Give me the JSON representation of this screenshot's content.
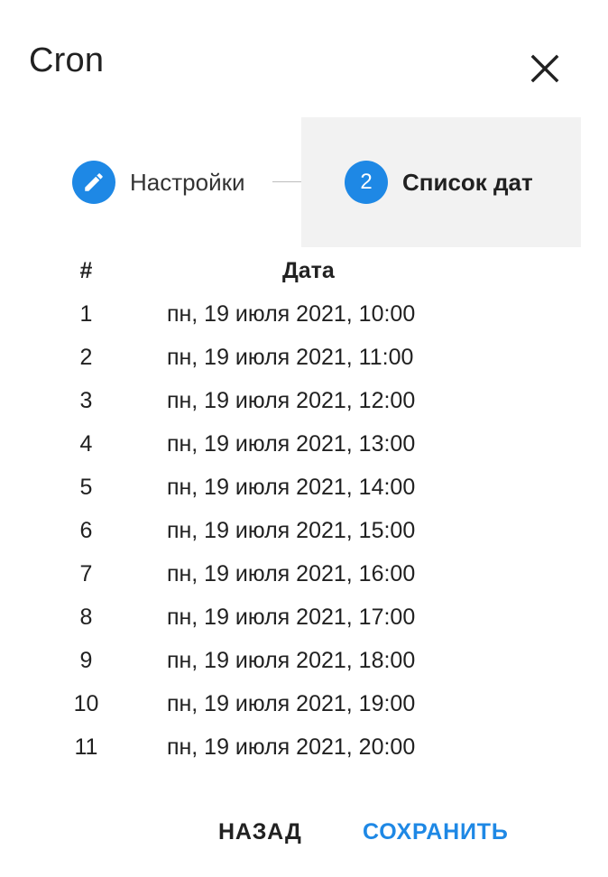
{
  "dialog": {
    "title": "Cron",
    "close_icon": "close-icon"
  },
  "stepper": {
    "steps": [
      {
        "icon": "pencil-icon",
        "label": "Настройки",
        "active": false
      },
      {
        "number": "2",
        "label": "Список дат",
        "active": true
      }
    ]
  },
  "table": {
    "headers": {
      "num": "#",
      "date": "Дата"
    },
    "rows": [
      {
        "num": "1",
        "date": "пн, 19 июля 2021, 10:00"
      },
      {
        "num": "2",
        "date": "пн, 19 июля 2021, 11:00"
      },
      {
        "num": "3",
        "date": "пн, 19 июля 2021, 12:00"
      },
      {
        "num": "4",
        "date": "пн, 19 июля 2021, 13:00"
      },
      {
        "num": "5",
        "date": "пн, 19 июля 2021, 14:00"
      },
      {
        "num": "6",
        "date": "пн, 19 июля 2021, 15:00"
      },
      {
        "num": "7",
        "date": "пн, 19 июля 2021, 16:00"
      },
      {
        "num": "8",
        "date": "пн, 19 июля 2021, 17:00"
      },
      {
        "num": "9",
        "date": "пн, 19 июля 2021, 18:00"
      },
      {
        "num": "10",
        "date": "пн, 19 июля 2021, 19:00"
      },
      {
        "num": "11",
        "date": "пн, 19 июля 2021, 20:00"
      }
    ]
  },
  "actions": {
    "back_label": "НАЗАД",
    "save_label": "СОХРАНИТЬ"
  },
  "colors": {
    "accent": "#1e88e5",
    "active_step_bg": "#f2f2f2",
    "text": "#212121"
  }
}
